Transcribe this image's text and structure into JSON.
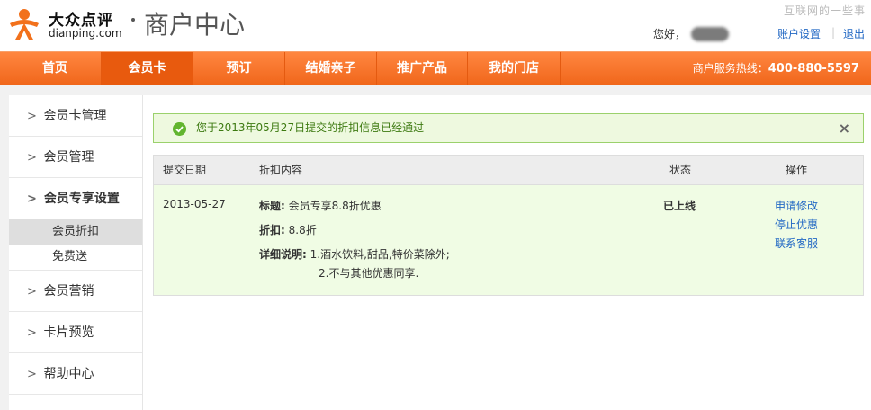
{
  "header": {
    "logo_cn": "大众点评",
    "logo_en": "dianping.com",
    "portal_title": "商户中心",
    "watermark": "互联网的一些事",
    "greeting": "您好，",
    "account_settings": "账户设置",
    "separator": "|",
    "logout": "退出"
  },
  "nav": {
    "items": [
      {
        "label": "首页"
      },
      {
        "label": "会员卡"
      },
      {
        "label": "预订"
      },
      {
        "label": "结婚亲子"
      },
      {
        "label": "推广产品"
      },
      {
        "label": "我的门店"
      }
    ],
    "active": "会员卡",
    "hotline_label": "商户服务热线：",
    "hotline_number": "400-880-5597"
  },
  "sidebar": {
    "items": [
      {
        "label": "会员卡管理",
        "chevron": ">"
      },
      {
        "label": "会员管理",
        "chevron": ">"
      },
      {
        "label": "会员专享设置",
        "chevron": ">"
      },
      {
        "label": "会员营销",
        "chevron": ">"
      },
      {
        "label": "卡片预览",
        "chevron": ">"
      },
      {
        "label": "帮助中心",
        "chevron": ">"
      }
    ],
    "subitems": [
      {
        "label": "会员折扣"
      },
      {
        "label": "免费送"
      }
    ]
  },
  "alert": {
    "text": "您于2013年05月27日提交的折扣信息已经通过",
    "close": "×",
    "icon": "check-circle-icon"
  },
  "table": {
    "headers": {
      "date": "提交日期",
      "content": "折扣内容",
      "status": "状态",
      "actions": "操作"
    },
    "row": {
      "date": "2013-05-27",
      "title_label": "标题:",
      "title_value": "会员专享8.8折优惠",
      "discount_label": "折扣:",
      "discount_value": "8.8折",
      "detail_label": "详细说明:",
      "detail_line1": "1.酒水饮料,甜品,特价菜除外;",
      "detail_line2": "2.不与其他优惠同享.",
      "status": "已上线",
      "actions": [
        "申请修改",
        "停止优惠",
        "联系客服"
      ]
    }
  },
  "colors": {
    "nav_orange": "#f0661a",
    "link_blue": "#2268c4",
    "alert_green": "#62b52f"
  }
}
